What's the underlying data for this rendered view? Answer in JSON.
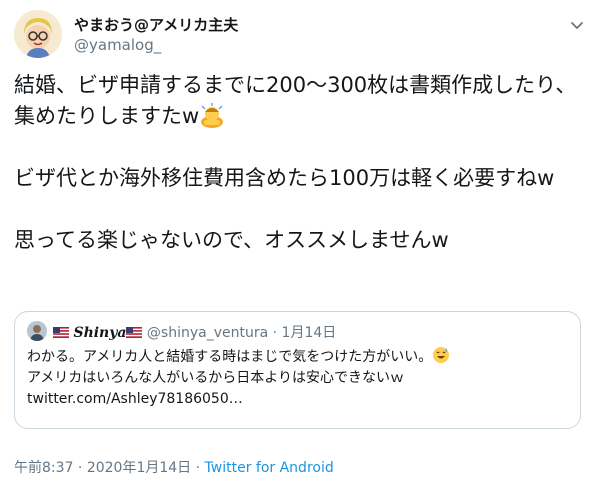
{
  "author": {
    "display_name": "やまおう@アメリカ主夫",
    "handle": "@yamalog_"
  },
  "tweet": {
    "text_1": "結婚、ビザ申請するまでに200〜300枚は書類作成したり、集めたりしますたw",
    "emoji_1": "person-bowing-emoji",
    "text_2": "\n\nビザ代とか海外移住費用含めたら100万は軽く必要すねw\n\n思ってる楽じゃないので、オススメしませんw"
  },
  "quote": {
    "name": "𝑺𝒉𝒊𝒏𝒚𝒂",
    "handle": "@shinya_ventura",
    "separator": "·",
    "date": "1月14日",
    "line_1": "わかる。アメリカ人と結婚する時はまじで気をつけた方がいい。",
    "line_1_emoji": "sweat-smile-emoji",
    "line_2": "\nアメリカはいろんな人がいるから日本よりは安心できないｗ\ntwitter.com/Ashley78186050…"
  },
  "meta": {
    "time": "午前8:37",
    "separator": "·",
    "date": "2020年1月14日",
    "separator_2": "·",
    "source": "Twitter for Android"
  },
  "colors": {
    "text": "#14171a",
    "secondary": "#657786",
    "link": "#1b95e0",
    "border": "#ccd6dd"
  }
}
